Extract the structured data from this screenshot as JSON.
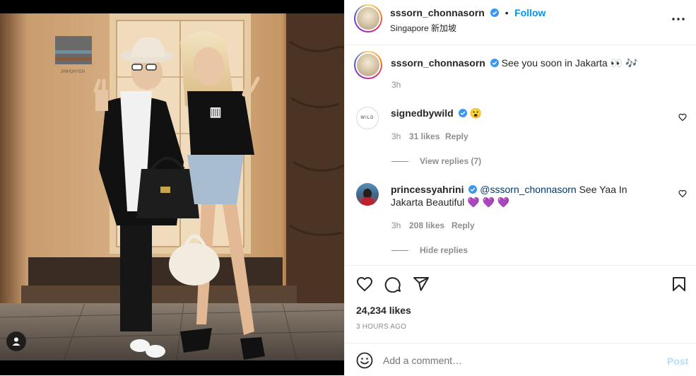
{
  "post": {
    "username": "sssorn_chonnasorn",
    "follow_label": "Follow",
    "location": "Singapore 新加坡",
    "more_icon": "more-horizontal-icon",
    "sign_text": "JINHOHYEN"
  },
  "caption": {
    "username": "sssorn_chonnasorn",
    "text": "See you soon in Jakarta 👀 🎶",
    "time": "3h"
  },
  "comments": [
    {
      "username": "signedbywild",
      "text": "😮",
      "time": "3h",
      "likes": "31 likes",
      "reply_label": "Reply",
      "avatar_text": "WILD",
      "replies_label": "View replies (7)"
    },
    {
      "username": "princessyahrini",
      "mention": "@sssorn_chonnasorn",
      "text": " See Yaa In Jakarta Beautiful 💜 💜 💜",
      "time": "3h",
      "likes": "208 likes",
      "reply_label": "Reply",
      "replies_label": "Hide replies"
    }
  ],
  "actions": {
    "likes": "24,234 likes",
    "time_ago": "3 HOURS AGO"
  },
  "add_comment": {
    "placeholder": "Add a comment…",
    "post_label": "Post"
  },
  "colors": {
    "accent": "#0095f6",
    "verified": "#3897f0",
    "muted": "#8e8e8e",
    "text": "#262626"
  }
}
